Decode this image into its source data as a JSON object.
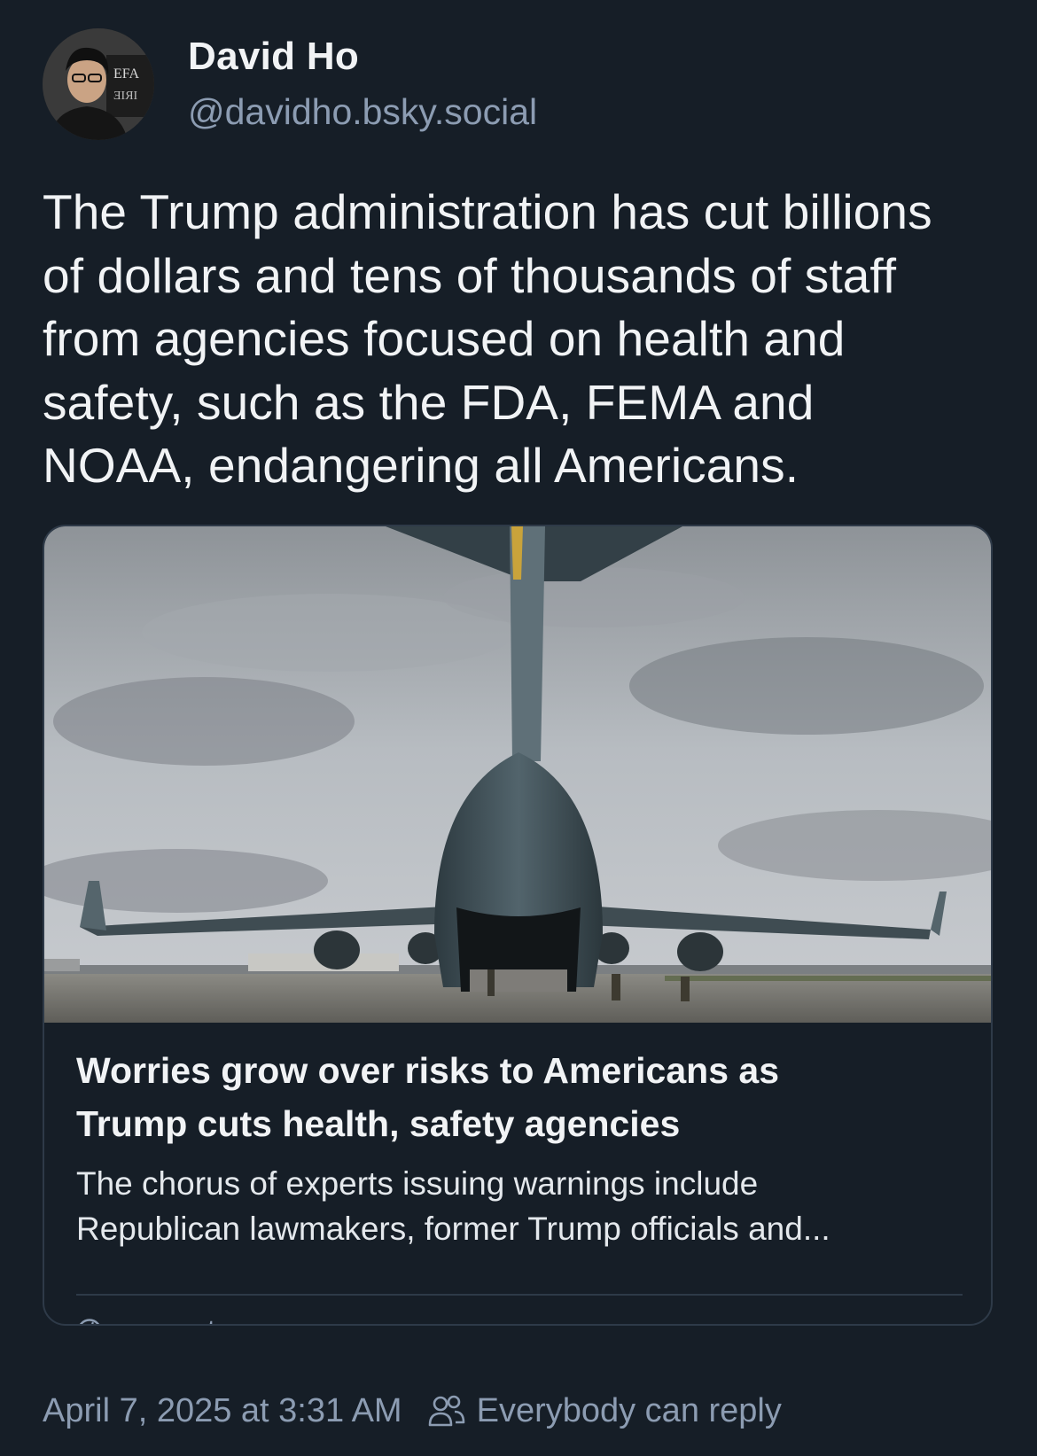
{
  "author": {
    "display_name": "David Ho",
    "handle": "@davidho.bsky.social",
    "avatar_icon": "avatar-photo"
  },
  "post": {
    "text": "The Trump administration has cut billions\nof dollars and tens of thousands of staff\nfrom agencies focused on health and\nsafety, such as the FDA, FEMA and\nNOAA, endangering all Americans."
  },
  "link_card": {
    "image_description_icon": "cargo-plane-photo",
    "title": "Worries grow over risks to Americans as\nTrump cuts health, safety agencies",
    "description": "The chorus of experts issuing warnings include\nRepublican lawmakers, former Trump officials and...",
    "source_icon": "globe-icon",
    "source_domain": "wapo.st"
  },
  "footer": {
    "timestamp": "April 7, 2025 at 3:31 AM",
    "reply_icon": "people-icon",
    "reply_setting": "Everybody can reply"
  },
  "colors": {
    "background": "#161e27",
    "text_primary": "#f1f3f5",
    "text_secondary": "#8c9cb2",
    "border": "#2e3a48"
  }
}
